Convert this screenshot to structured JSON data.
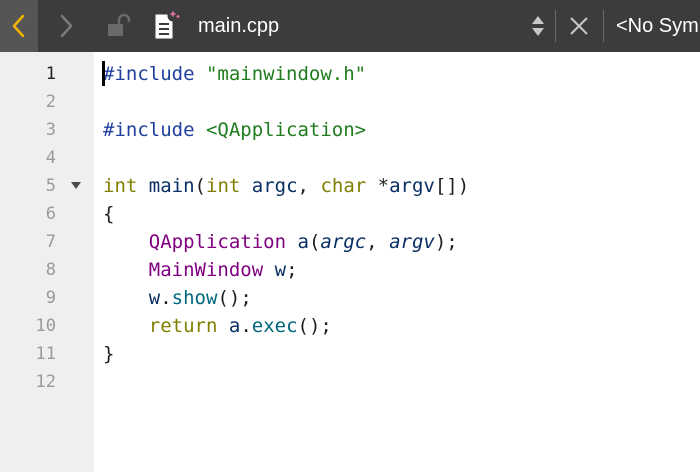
{
  "toolbar": {
    "filename": "main.cpp",
    "symbols": "<No Sym",
    "icons": [
      "chevron-left-icon",
      "chevron-right-icon",
      "lock-icon",
      "new-file-icon",
      "up-down-arrows-icon",
      "close-icon"
    ]
  },
  "editor": {
    "line_numbers": [
      "1",
      "2",
      "3",
      "4",
      "5",
      "6",
      "7",
      "8",
      "9",
      "10",
      "11",
      "12"
    ],
    "lines": [
      [
        {
          "t": "#include ",
          "c": "pp"
        },
        {
          "t": "\"mainwindow.h\"",
          "c": "str"
        }
      ],
      [],
      [
        {
          "t": "#include ",
          "c": "pp"
        },
        {
          "t": "<QApplication>",
          "c": "str"
        }
      ],
      [],
      [
        {
          "t": "int",
          "c": "kw"
        },
        {
          "t": " ",
          "c": "pl"
        },
        {
          "t": "main",
          "c": "var"
        },
        {
          "t": "(",
          "c": "pl"
        },
        {
          "t": "int",
          "c": "kw"
        },
        {
          "t": " ",
          "c": "pl"
        },
        {
          "t": "argc",
          "c": "var"
        },
        {
          "t": ", ",
          "c": "pl"
        },
        {
          "t": "char",
          "c": "kw"
        },
        {
          "t": " *",
          "c": "pl"
        },
        {
          "t": "argv",
          "c": "var"
        },
        {
          "t": "[])",
          "c": "pl"
        }
      ],
      [
        {
          "t": "{",
          "c": "pl"
        }
      ],
      [
        {
          "t": "    ",
          "c": "pl"
        },
        {
          "t": "QApplication",
          "c": "ty"
        },
        {
          "t": " ",
          "c": "pl"
        },
        {
          "t": "a",
          "c": "var"
        },
        {
          "t": "(",
          "c": "pl"
        },
        {
          "t": "argc",
          "c": "par"
        },
        {
          "t": ", ",
          "c": "pl"
        },
        {
          "t": "argv",
          "c": "par"
        },
        {
          "t": ");",
          "c": "pl"
        }
      ],
      [
        {
          "t": "    ",
          "c": "pl"
        },
        {
          "t": "MainWindow",
          "c": "ty"
        },
        {
          "t": " ",
          "c": "pl"
        },
        {
          "t": "w",
          "c": "var"
        },
        {
          "t": ";",
          "c": "pl"
        }
      ],
      [
        {
          "t": "    ",
          "c": "pl"
        },
        {
          "t": "w",
          "c": "var"
        },
        {
          "t": ".",
          "c": "pl"
        },
        {
          "t": "show",
          "c": "fn"
        },
        {
          "t": "();",
          "c": "pl"
        }
      ],
      [
        {
          "t": "    ",
          "c": "pl"
        },
        {
          "t": "return",
          "c": "kw"
        },
        {
          "t": " ",
          "c": "pl"
        },
        {
          "t": "a",
          "c": "var"
        },
        {
          "t": ".",
          "c": "pl"
        },
        {
          "t": "exec",
          "c": "fn"
        },
        {
          "t": "();",
          "c": "pl"
        }
      ],
      [
        {
          "t": "}",
          "c": "pl"
        }
      ],
      []
    ],
    "current_line": 1,
    "fold_marker_line": 5
  }
}
